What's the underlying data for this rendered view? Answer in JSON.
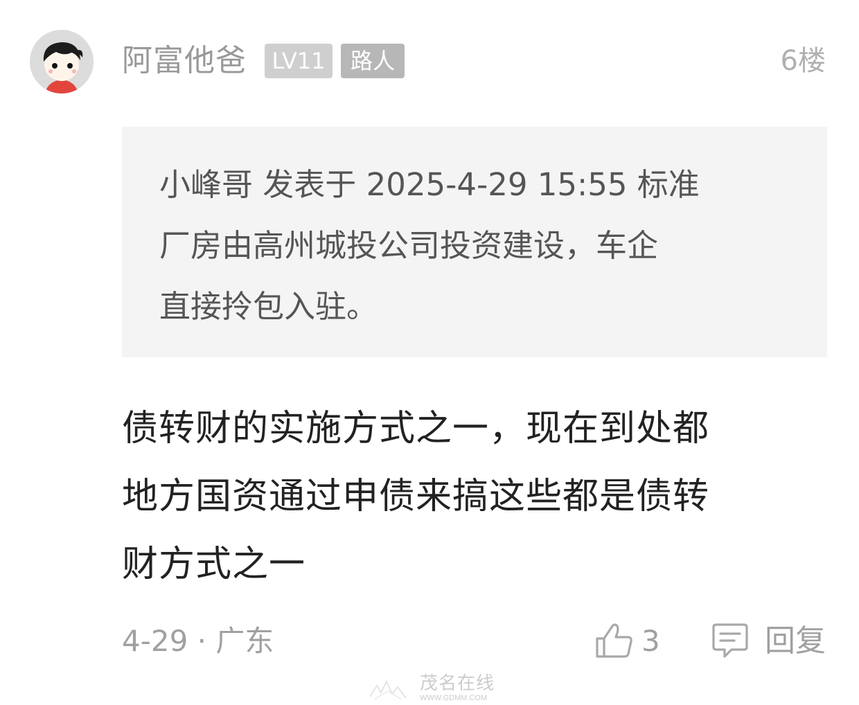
{
  "post": {
    "username": "阿富他爸",
    "level_badge": "LV11",
    "title_badge": "路人",
    "floor": "6楼",
    "quote": {
      "lines": [
        "小峰哥 发表于 2025-4-29 15:55 标准",
        "厂房由高州城投公司投资建设，车企",
        "直接拎包入驻。"
      ]
    },
    "content": {
      "lines": [
        "债转财的实施方式之一，现在到处都",
        "地方国资通过申债来搞这些都是债转",
        "财方式之一"
      ]
    },
    "meta": "4-29 · 广东",
    "like_count": "3",
    "reply_label": "回复"
  },
  "watermark": {
    "text": "茂名在线",
    "url": "WWW.GDMM.COM"
  },
  "colors": {
    "quote_background": "#f4f4f4",
    "badge_level": "#cfcfcf",
    "badge_title": "#b7b7b7",
    "muted_text": "#a0a0a0"
  }
}
